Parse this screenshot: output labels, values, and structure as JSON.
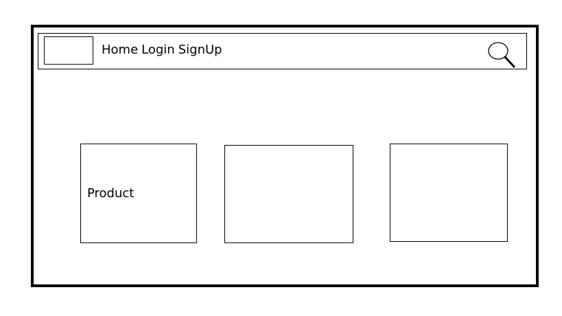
{
  "header": {
    "nav": {
      "home": "Home",
      "login": "Login",
      "signup": "SignUp"
    },
    "search_icon": "search-icon"
  },
  "products": [
    {
      "label": "Product"
    },
    {
      "label": ""
    },
    {
      "label": ""
    }
  ],
  "colors": {
    "border": "#000000",
    "background": "#ffffff",
    "text": "#000000"
  }
}
